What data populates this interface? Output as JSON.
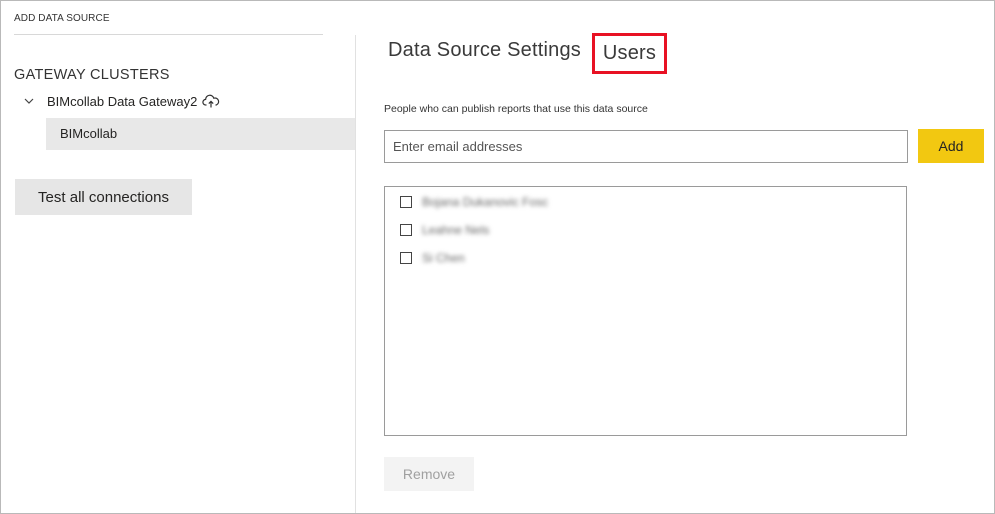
{
  "header": {
    "title": "ADD DATA SOURCE"
  },
  "sidebar": {
    "section_title": "GATEWAY CLUSTERS",
    "gateway": {
      "name": "BIMcollab Data Gateway2",
      "expand_icon": "chevron-down-icon",
      "status_icon": "cloud-upload-icon"
    },
    "data_source": {
      "label": "BIMcollab"
    },
    "test_button": "Test all connections"
  },
  "tabs": [
    {
      "label": "Data Source Settings",
      "active": false
    },
    {
      "label": "Users",
      "active": true,
      "highlight_color": "#e81123"
    }
  ],
  "users_panel": {
    "description": "People who can publish reports that use this data source",
    "email_input": {
      "value": "",
      "placeholder": "Enter email addresses"
    },
    "add_button": "Add",
    "users": [
      {
        "name": "Bojana Dukanovic Fosc",
        "checked": false,
        "blurred": true
      },
      {
        "name": "Leahne Nels",
        "checked": false,
        "blurred": true
      },
      {
        "name": "Si Chen",
        "checked": false,
        "blurred": true
      }
    ],
    "remove_button": "Remove"
  },
  "colors": {
    "accent": "#f2c811",
    "selected_item_bg": "#e8e8e8",
    "highlight_box": "#e81123"
  }
}
